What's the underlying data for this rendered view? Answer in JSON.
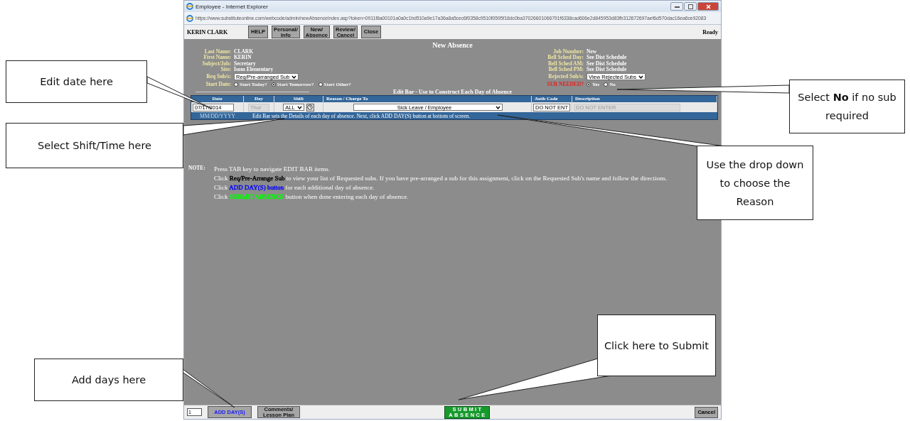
{
  "window": {
    "title": "Employee - Internet Explorer",
    "address": "https://www.substituteonline.com/webcode/admin/newAbsenceIndex.asp?token=0911f8a00101a0a0c1bd510a9e17a36a8a5cec6f0358c9510f0595f18dc0ba37026601066791f6338cad606e2d845953d83fb312672697aef6d570dac16ea6ce92083"
  },
  "app_toolbar": {
    "user": "KERIN CLARK",
    "buttons": [
      "HELP",
      "Personal/ Info",
      "New/ Absence",
      "Review/ Cancel",
      "Close"
    ],
    "status": "Ready"
  },
  "form": {
    "title": "New Absence",
    "left_fields": [
      {
        "kind": "text",
        "label": "Last Name:",
        "value": "CLARK"
      },
      {
        "kind": "text",
        "label": "First Name:",
        "value": "KERIN"
      },
      {
        "kind": "text",
        "label": "Subject/Job:",
        "value": "Secretary"
      },
      {
        "kind": "text",
        "label": "Site:",
        "value": "Isom Elementary"
      },
      {
        "kind": "select",
        "label": "Req Sub/s:",
        "value": "Req/Pre-arranged Sub"
      },
      {
        "kind": "radios",
        "label": "Start Date:",
        "options": [
          {
            "label": "Start Today?",
            "selected": false
          },
          {
            "label": "Start Tomorrow?",
            "selected": true
          },
          {
            "label": "Start Other?",
            "selected": false
          }
        ]
      }
    ],
    "right_fields": [
      {
        "kind": "text",
        "label": "Job Number:",
        "value": "New"
      },
      {
        "kind": "text",
        "label": "Bell Sched Day:",
        "value": "See Dist Schedule"
      },
      {
        "kind": "text",
        "label": "Bell Sched AM:",
        "value": "See Dist Schedule"
      },
      {
        "kind": "text",
        "label": "Bell Sched PM:",
        "value": "See Dist Schedule"
      },
      {
        "kind": "select",
        "label": "Rejected Sub/s:",
        "value": "View Rejected Subs"
      },
      {
        "kind": "radios",
        "label": "SUB NEEDED?",
        "alert": true,
        "options": [
          {
            "label": "Yes",
            "selected": true
          },
          {
            "label": "No",
            "selected": false
          }
        ]
      }
    ]
  },
  "edit_bar": {
    "title": "Edit Bar - Use to Construct Each Day of Absence",
    "columns": [
      "Date",
      "Day",
      "Shift",
      "Reason / Charge To",
      "Auth Code",
      "Description"
    ],
    "cells": [
      {
        "kind": "input",
        "value": "07/17/2014"
      },
      {
        "kind": "disabled",
        "value": "Thur"
      },
      {
        "kind": "shift",
        "value": "ALL"
      },
      {
        "kind": "select",
        "value": "Sick Leave / Employee"
      },
      {
        "kind": "input",
        "value": "DO NOT ENT"
      },
      {
        "kind": "disabled",
        "value": "DO NOT ENTER"
      }
    ],
    "format_hint": "MM/DD/YYYY",
    "note": "Edit Bar sets the Details of each day of absence. Next, click ADD DAY(S) button at bottom of screen."
  },
  "notes": {
    "label": "NOTE:",
    "items": [
      {
        "parts": [
          {
            "text": "Press TAB key to navigate EDIT BAR items."
          }
        ]
      },
      {
        "parts": [
          {
            "text": "Click "
          },
          {
            "color": "#000000",
            "text": "Req/Pre-Arrange Sub"
          },
          {
            "text": " to view your list of Requested subs. If you have pre-arranged a sub for this assignment, click on the Requested Sub's name and follow the directions."
          }
        ]
      },
      {
        "parts": [
          {
            "text": "Click "
          },
          {
            "color": "#0000ff",
            "text": "ADD DAY(S) button"
          },
          {
            "text": " for each additional day of absence."
          }
        ]
      },
      {
        "parts": [
          {
            "text": "Click "
          },
          {
            "color": "#00ff00",
            "text": "SUBMIT ABSENCE"
          },
          {
            "text": " button when done entering each day of absence."
          }
        ]
      }
    ]
  },
  "bottom_bar": {
    "day_count": "1",
    "add_button": "ADD DAY(S)",
    "comments_button": "Comments/ Lesson Plan",
    "submit_button": "SUBMIT ABSENCE",
    "cancel_button": "Cancel"
  },
  "callouts": [
    {
      "text": "Edit date here"
    },
    {
      "text": "Select Shift/Time here"
    },
    {
      "text": "Select **No** if no sub required"
    },
    {
      "text": "Use the drop down to choose the Reason"
    },
    {
      "text": "Click here to Submit"
    },
    {
      "text": "Add days here"
    }
  ]
}
